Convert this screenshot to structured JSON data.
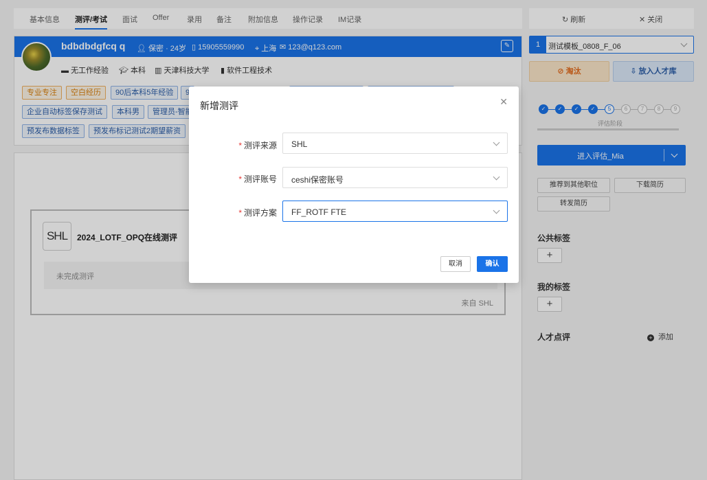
{
  "tabs": [
    "基本信息",
    "测评/考试",
    "面试",
    "Offer",
    "录用",
    "备注",
    "附加信息",
    "操作记录",
    "IM记录"
  ],
  "candidate": {
    "name": "bdbdbdgfcq q",
    "privacy_age": "保密 · 24岁",
    "phone": "15905559990",
    "city": "上海",
    "email": "123@q123.com",
    "experience": "无工作经验",
    "degree": "本科",
    "school": "天津科技大学",
    "major": "软件工程技术"
  },
  "tags": {
    "row1": [
      "专业专注",
      "空白经历",
      "90后本科5年经验",
      "9"
    ],
    "row2": [
      "企业自动标签保存测试",
      "本科男",
      "管理员-智能"
    ],
    "row3": [
      "预发布数据标签",
      "预发布标记测试2期望薪资"
    ]
  },
  "assessment_card": {
    "logo": "SHL",
    "title": "2024_LOTF_OPQ在线测评",
    "status": "未完成测评",
    "source": "来自 SHL"
  },
  "right_panel": {
    "refresh": "刷新",
    "close": "关闭",
    "template_num": "1",
    "template_name": "测试模板_0808_F_06",
    "reject": "淘汰",
    "talent_pool": "放入人才库",
    "steps": [
      "5",
      "6",
      "7",
      "8",
      "9"
    ],
    "stage_label": "评估阶段",
    "enter_btn": "进入评估_Mia",
    "recommend": "推荐到其他职位",
    "download": "下载简历",
    "forward": "转发简历",
    "public_tags": "公共标签",
    "my_tags": "我的标签",
    "plus": "+",
    "comment": "人才点评",
    "add": "添加"
  },
  "modal": {
    "title": "新增测评",
    "fields": [
      {
        "label": "测评来源",
        "value": "SHL"
      },
      {
        "label": "测评账号",
        "value": "ceshi保密账号"
      },
      {
        "label": "测评方案",
        "value": "FF_ROTF FTE"
      }
    ],
    "cancel": "取消",
    "confirm": "确认"
  },
  "colors": {
    "primary": "#1a73e8",
    "reject_text": "#e26a1c",
    "required": "#e53935"
  }
}
